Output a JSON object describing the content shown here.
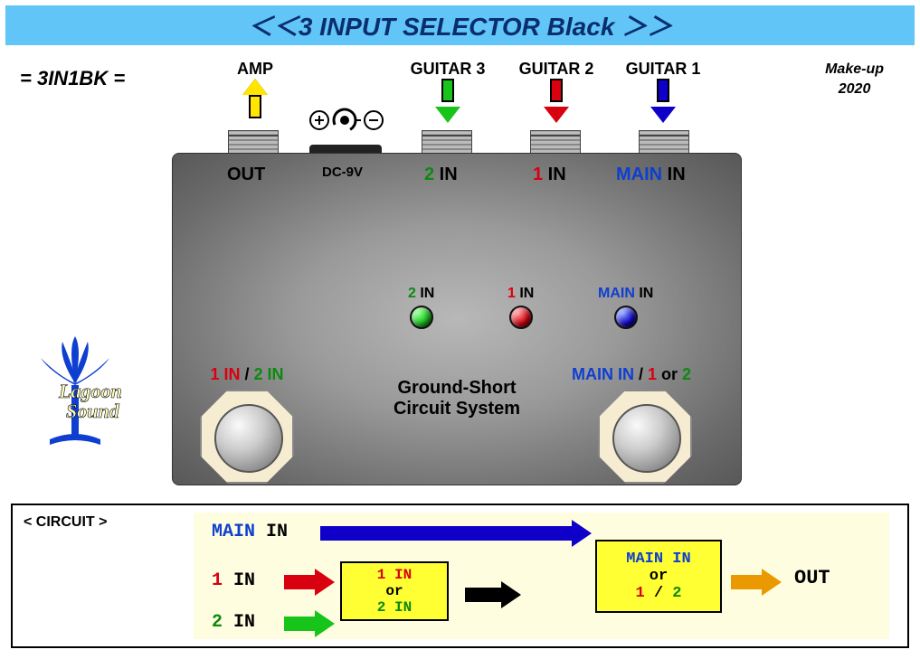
{
  "header": {
    "title": "＜＜3 INPUT SELECTOR Black ＞＞"
  },
  "model": "= 3IN1BK =",
  "makeup": {
    "l1": "Make-up",
    "l2": "2020"
  },
  "jacks": {
    "amp": {
      "label": "AMP",
      "port": "OUT",
      "color": "#ffe500"
    },
    "g3": {
      "label": "GUITAR 3",
      "port_a": "2",
      "port_b": " IN",
      "color": "#17c41a"
    },
    "g2": {
      "label": "GUITAR 2",
      "port_a": "1",
      "port_b": " IN",
      "color": "#d9000f"
    },
    "g1": {
      "label": "GUITAR 1",
      "port_a": "MAIN",
      "port_b": " IN",
      "color": "#0e00c9"
    }
  },
  "dc": {
    "label": "DC-9V"
  },
  "leds": {
    "l2": {
      "a": "2",
      "b": " IN",
      "color": "#17c41a"
    },
    "l1": {
      "a": "1",
      "b": " IN",
      "color": "#d9000f"
    },
    "lm": {
      "a": "MAIN",
      "b": " IN",
      "color": "#0e00c9"
    }
  },
  "center": {
    "l1": "Ground-Short",
    "l2": "Circuit System"
  },
  "fs": {
    "left": {
      "a": "1 IN",
      "sep": " / ",
      "b": "2 IN"
    },
    "right": {
      "a": "MAIN IN",
      "sep": " / ",
      "b": "1",
      "or": " or ",
      "c": "2"
    }
  },
  "logo": {
    "l1": "Lagoon",
    "l2": "Sound"
  },
  "circuit": {
    "title": "< CIRCUIT >",
    "main": {
      "a": "MAIN",
      "b": "  IN"
    },
    "in1": {
      "a": "1",
      "b": "  IN"
    },
    "in2": {
      "a": "2",
      "b": "  IN"
    },
    "box1": {
      "a": "1  IN",
      "or": "or",
      "b": "2  IN"
    },
    "box2": {
      "a": "MAIN  IN",
      "or": "or",
      "b": "1",
      "sep": " / ",
      "c": "2"
    },
    "out": "OUT"
  },
  "colors": {
    "blue": "#0e3fd0",
    "red": "#d9000f",
    "green": "#0b8a0e",
    "orange": "#eb9900"
  }
}
